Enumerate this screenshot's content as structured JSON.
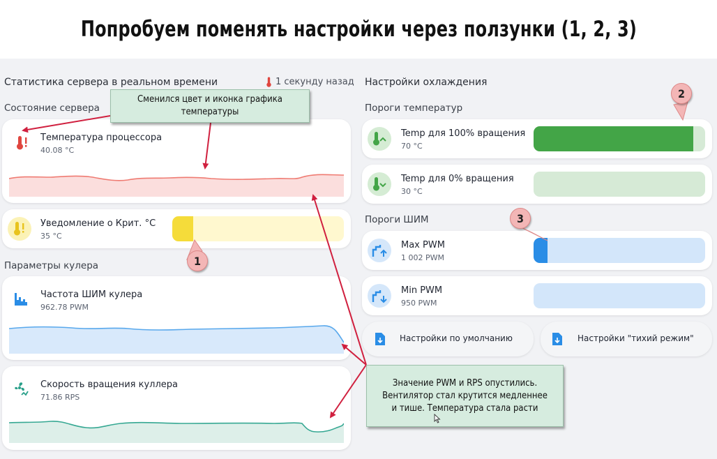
{
  "headline": "Попробуем поменять настройки через ползунки (1, 2, 3)",
  "stats": {
    "title": "Статистика сервера в реальном времени",
    "updated": "1 секунду назад",
    "server_state_title": "Состояние сервера",
    "cpu_temp": {
      "label": "Температура процессора",
      "value": "40.08 °C"
    },
    "crit_alert": {
      "label": "Уведомление о Крит. °C",
      "value": "35 °C",
      "level_percent": 12
    },
    "cooler_title": "Параметры кулера",
    "pwm_freq": {
      "label": "Частота ШИМ кулера",
      "value": "962.78 PWM"
    },
    "fan_speed": {
      "label": "Скорость вращения куллера",
      "value": "71.86 RPS"
    }
  },
  "cooling": {
    "title": "Настройки охлаждения",
    "temp_thresholds_title": "Пороги температур",
    "temp_100": {
      "label": "Temp для 100% вращения",
      "value": "70 °C",
      "level_percent": 93
    },
    "temp_0": {
      "label": "Temp для 0% вращения",
      "value": "30 °C",
      "level_percent": 0
    },
    "pwm_thresholds_title": "Пороги ШИМ",
    "max_pwm": {
      "label": "Max PWM",
      "value": "1 002 PWM",
      "level_percent": 8
    },
    "min_pwm": {
      "label": "Min PWM",
      "value": "950 PWM",
      "level_percent": 0
    },
    "default_btn": "Настройки по умолчанию",
    "quiet_btn": "Настройки \"тихий режим\""
  },
  "annotations": {
    "callout_top": "Сменился цвет и иконка графика\nтемпературы",
    "callout_bottom": "Значение PWM и RPS опустились.\nВентилятор стал крутится медленнее\nи тише. Температура стала расти",
    "badge1": "1",
    "badge2": "2",
    "badge3": "3"
  },
  "colors": {
    "temp_red": "#e0463f",
    "alert_yellow": "#f5dc3a",
    "green": "#43a547",
    "blue": "#2a8de6",
    "teal": "#2aa08a",
    "arrow": "#d0203f"
  }
}
